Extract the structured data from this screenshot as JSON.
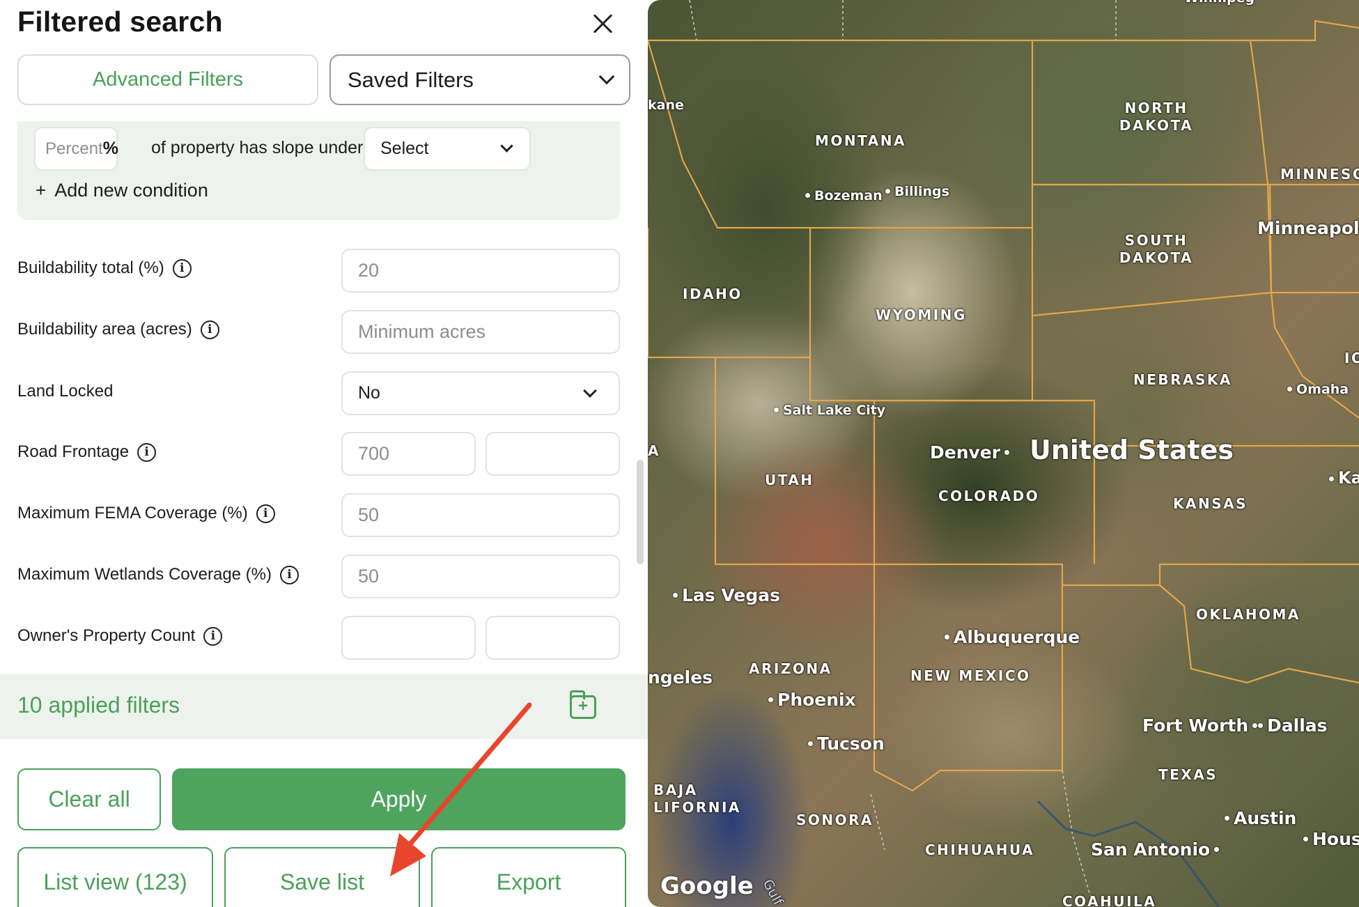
{
  "header": {
    "title": "Filtered search"
  },
  "tabs": {
    "advanced_label": "Advanced Filters",
    "saved_label": "Saved Filters"
  },
  "condition": {
    "percent_placeholder": "Percent",
    "percent_symbol": "%",
    "slope_text": "of property has slope under",
    "select_value": "Select",
    "add_label": "Add new condition"
  },
  "filters": {
    "buildability_total": {
      "label": "Buildability total (%)",
      "value": "20"
    },
    "buildability_area": {
      "label": "Buildability area (acres)",
      "placeholder": "Minimum acres"
    },
    "land_locked": {
      "label": "Land Locked",
      "value": "No"
    },
    "road_frontage": {
      "label": "Road Frontage",
      "min": "700",
      "max": ""
    },
    "fema": {
      "label": "Maximum FEMA Coverage (%)",
      "value": "50"
    },
    "wetlands": {
      "label": "Maximum Wetlands Coverage (%)",
      "value": "50"
    },
    "owner_count": {
      "label": "Owner's Property Count",
      "min": "",
      "max": ""
    }
  },
  "applied": {
    "text": "10 applied filters"
  },
  "buttons": {
    "clear_all": "Clear all",
    "apply": "Apply",
    "list_view": "List view (123)",
    "save_list": "Save list",
    "export": "Export"
  },
  "map": {
    "country": "United States",
    "states": {
      "north_dakota": "NORTH DAKOTA",
      "south_dakota": "SOUTH DAKOTA",
      "montana": "MONTANA",
      "wyoming": "WYOMING",
      "idaho": "IDAHO",
      "nebraska": "NEBRASKA",
      "utah": "UTAH",
      "colorado": "COLORADO",
      "kansas": "KANSAS",
      "oklahoma": "OKLAHOMA",
      "arizona": "ARIZONA",
      "new_mexico": "NEW MEXICO",
      "texas": "TEXAS",
      "sonora": "SONORA",
      "chihuahua": "CHIHUAHUA",
      "coahuila": "COAHUILA",
      "baja": "BAJA\nLIFORNIA",
      "minneso": "MINNESO",
      "io": "IO",
      "a_cut": "A"
    },
    "cities": {
      "winnipeg": "Winnipeg",
      "kane": "kane",
      "bozeman": "Bozeman",
      "billings": "Billings",
      "minneapolis": "Minneapolis",
      "omaha": "Omaha",
      "salt_lake": "Salt Lake City",
      "denver": "Denver",
      "ka": "Ka",
      "las_vegas": "Las Vegas",
      "albuquerque": "Albuquerque",
      "angeles": "ngeles",
      "phoenix": "Phoenix",
      "tucson": "Tucson",
      "fort_worth": "Fort Worth",
      "dallas": "Dallas",
      "austin": "Austin",
      "houston": "Hous",
      "san_antonio": "San Antonio",
      "gulf": "Gulf"
    },
    "attribution": "Google"
  },
  "colors": {
    "accent_green": "#4ea45d",
    "panel_tint": "#eef2ec",
    "border_line": "#e3a64b",
    "arrow_red": "#e8452f"
  }
}
